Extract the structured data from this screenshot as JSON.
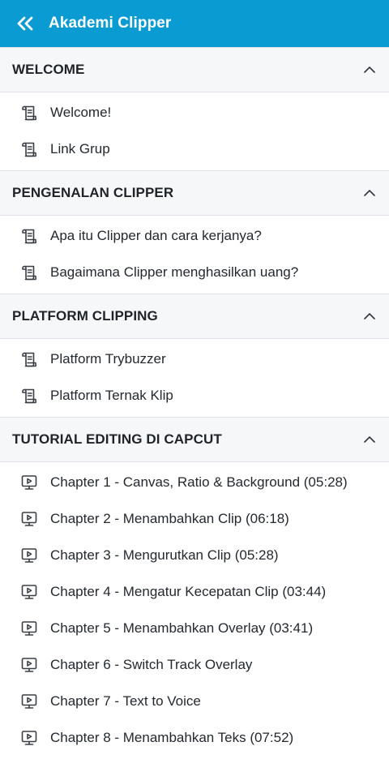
{
  "header": {
    "title": "Akademi Clipper",
    "back_icon": "double-chevron-left-icon",
    "background_color": "#0a9bd3"
  },
  "sections": [
    {
      "title": "WELCOME",
      "items": [
        {
          "label": "Welcome!",
          "icon": "scroll-icon"
        },
        {
          "label": "Link Grup",
          "icon": "scroll-icon"
        }
      ]
    },
    {
      "title": "PENGENALAN CLIPPER",
      "items": [
        {
          "label": "Apa itu Clipper dan cara kerjanya?",
          "icon": "scroll-icon"
        },
        {
          "label": "Bagaimana Clipper menghasilkan uang?",
          "icon": "scroll-icon"
        }
      ]
    },
    {
      "title": "PLATFORM CLIPPING",
      "items": [
        {
          "label": "Platform Trybuzzer",
          "icon": "scroll-icon"
        },
        {
          "label": "Platform Ternak Klip",
          "icon": "scroll-icon"
        }
      ]
    },
    {
      "title": "TUTORIAL EDITING DI CAPCUT",
      "items": [
        {
          "label": "Chapter 1 - Canvas, Ratio & Background (05:28)",
          "icon": "video-icon"
        },
        {
          "label": "Chapter 2 - Menambahkan Clip (06:18)",
          "icon": "video-icon"
        },
        {
          "label": "Chapter 3 - Mengurutkan Clip (05:28)",
          "icon": "video-icon"
        },
        {
          "label": "Chapter 4 - Mengatur Kecepatan Clip (03:44)",
          "icon": "video-icon"
        },
        {
          "label": "Chapter 5 - Menambahkan Overlay (03:41)",
          "icon": "video-icon"
        },
        {
          "label": "Chapter 6 - Switch Track Overlay",
          "icon": "video-icon"
        },
        {
          "label": "Chapter 7 - Text to Voice",
          "icon": "video-icon"
        },
        {
          "label": "Chapter 8 - Menambahkan Teks (07:52)",
          "icon": "video-icon"
        }
      ]
    }
  ]
}
